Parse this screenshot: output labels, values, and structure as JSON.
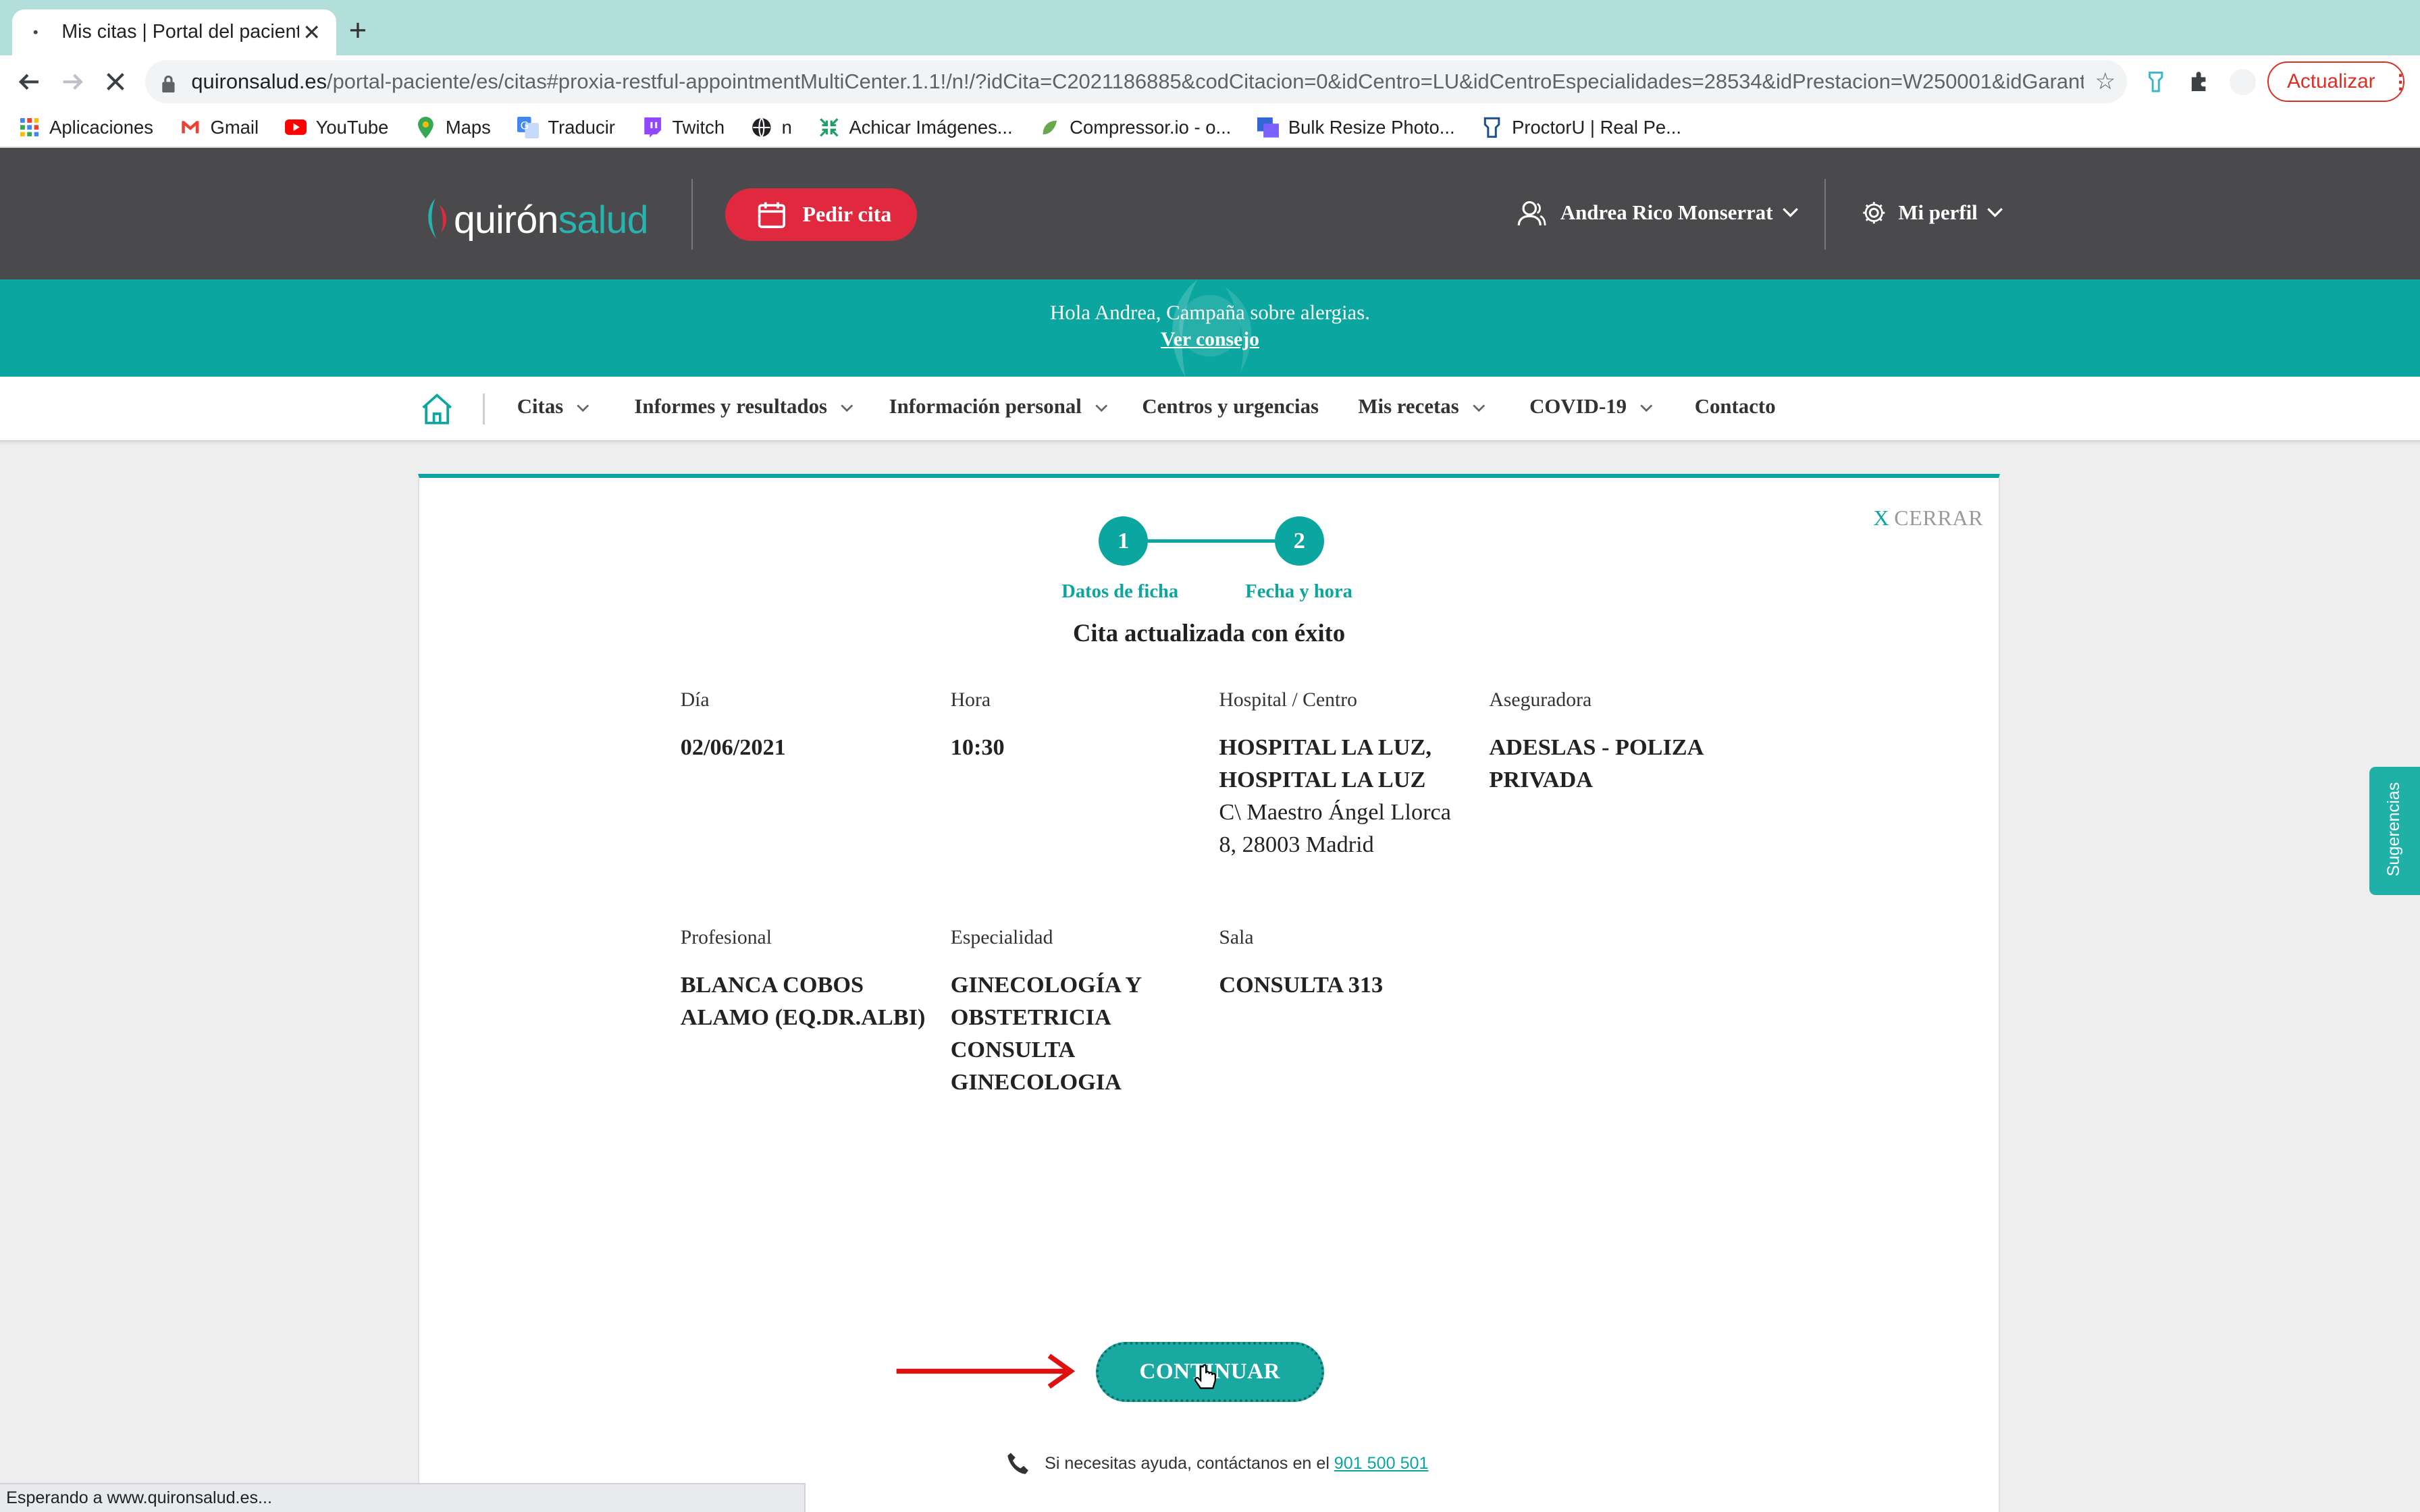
{
  "browser": {
    "tab_title": "Mis citas | Portal del paciente",
    "url_host": "quironsalud.es",
    "url_path": "/portal-paciente/es/citas#proxia-restful-appointmentMultiCenter.1.1!/n!/?idCita=C2021186885&codCitacion=0&idCentro=LU&idCentroEspecialidades=28534&idPrestacion=W250001&idGarante=...",
    "update_label": "Actualizar",
    "bookmarks": [
      {
        "label": "Aplicaciones",
        "icon": "apps-grid-icon"
      },
      {
        "label": "Gmail",
        "icon": "gmail-icon"
      },
      {
        "label": "YouTube",
        "icon": "youtube-icon"
      },
      {
        "label": "Maps",
        "icon": "maps-pin-icon"
      },
      {
        "label": "Traducir",
        "icon": "translate-icon"
      },
      {
        "label": "Twitch",
        "icon": "twitch-icon"
      },
      {
        "label": "n",
        "icon": "globe-icon"
      },
      {
        "label": "Achicar Imágenes...",
        "icon": "shrink-icon"
      },
      {
        "label": "Compressor.io - o...",
        "icon": "compressor-icon"
      },
      {
        "label": "Bulk Resize Photo...",
        "icon": "bulk-resize-icon"
      },
      {
        "label": "ProctorU | Real Pe...",
        "icon": "proctoru-icon"
      }
    ],
    "status_text": "Esperando a www.quironsalud.es..."
  },
  "header": {
    "logo_part1": "quirón",
    "logo_part2": "salud",
    "pedir_cita": "Pedir cita",
    "user_name": "Andrea Rico Monserrat",
    "profile": "Mi perfil"
  },
  "banner": {
    "text": "Hola Andrea,  Campaña sobre alergias.",
    "link": "Ver consejo"
  },
  "nav": {
    "items": [
      "Citas",
      "Informes y resultados",
      "Información personal",
      "Centros y urgencias",
      "Mis recetas",
      "COVID-19",
      "Contacto"
    ]
  },
  "card": {
    "close_label": "CERRAR",
    "close_x": "X",
    "steps": [
      {
        "number": "1",
        "label": "Datos de ficha"
      },
      {
        "number": "2",
        "label": "Fecha y hora"
      }
    ],
    "title": "Cita actualizada con éxito",
    "fields": {
      "dia": {
        "label": "Día",
        "value": "02/06/2021"
      },
      "hora": {
        "label": "Hora",
        "value": "10:30"
      },
      "hospital": {
        "label": "Hospital / Centro",
        "line1": "HOSPITAL LA LUZ,",
        "line2": "HOSPITAL LA LUZ",
        "address1": "C\\ Maestro Ángel Llorca",
        "address2": "8, 28003 Madrid"
      },
      "aseguradora": {
        "label": "Aseguradora",
        "line1": "ADESLAS - POLIZA",
        "line2": "PRIVADA"
      },
      "profesional": {
        "label": "Profesional",
        "line1": "BLANCA COBOS",
        "line2": "ALAMO (EQ.DR.ALBI)"
      },
      "especialidad": {
        "label": "Especialidad",
        "line1": "GINECOLOGÍA Y",
        "line2": "OBSTETRICIA",
        "line3": "CONSULTA",
        "line4": "GINECOLOGIA"
      },
      "sala": {
        "label": "Sala",
        "value": "CONSULTA 313"
      }
    },
    "continue_label": "CONTINUAR",
    "help_text": "Si necesitas ayuda, contáctanos en el",
    "help_phone": "901 500 501"
  },
  "sidebar_tab": "Sugerencias",
  "colors": {
    "teal": "#0aa69f",
    "brand_red": "#e0283f",
    "header_bg": "#4a4a4d"
  }
}
